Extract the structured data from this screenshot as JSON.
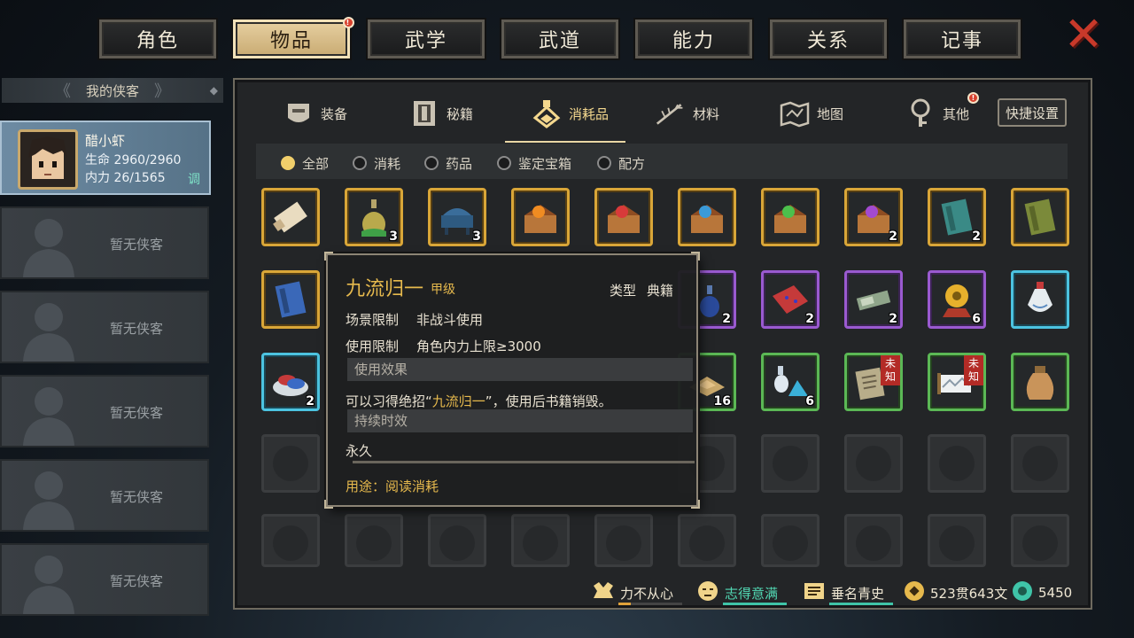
{
  "top_tabs": [
    {
      "label": "角色",
      "active": false
    },
    {
      "label": "物品",
      "active": true,
      "badge": "!"
    },
    {
      "label": "武学",
      "active": false
    },
    {
      "label": "武道",
      "active": false
    },
    {
      "label": "能力",
      "active": false
    },
    {
      "label": "关系",
      "active": false
    },
    {
      "label": "记事",
      "active": false
    }
  ],
  "close_glyph": "✕",
  "sidebar": {
    "title": "我的侠客",
    "hero": {
      "name": "醋小虾",
      "hp_label": "生命 2960/2960",
      "mp_label": "内力 26/1565",
      "adjust_label": "调"
    },
    "empty_slots": [
      "暂无侠客",
      "暂无侠客",
      "暂无侠客",
      "暂无侠客",
      "暂无侠客"
    ]
  },
  "categories": [
    {
      "label": "装备",
      "icon": "armor-icon"
    },
    {
      "label": "秘籍",
      "icon": "book-icon"
    },
    {
      "label": "消耗品",
      "icon": "potion-icon",
      "active": true
    },
    {
      "label": "材料",
      "icon": "herb-icon"
    },
    {
      "label": "地图",
      "icon": "map-icon"
    },
    {
      "label": "其他",
      "icon": "key-icon",
      "badge": "!"
    }
  ],
  "quick_settings_label": "快捷设置",
  "filters": [
    {
      "label": "全部",
      "selected": true
    },
    {
      "label": "消耗",
      "selected": false
    },
    {
      "label": "药品",
      "selected": false
    },
    {
      "label": "鉴定宝箱",
      "selected": false
    },
    {
      "label": "配方",
      "selected": false
    }
  ],
  "items_row1": [
    {
      "icon": "scroll-icon",
      "rarity": "gold",
      "count": ""
    },
    {
      "icon": "gourd-icon",
      "rarity": "gold",
      "count": "3"
    },
    {
      "icon": "incense-burner-icon",
      "rarity": "gold",
      "count": "3"
    },
    {
      "icon": "treasure-chest-orange-icon",
      "rarity": "gold",
      "count": ""
    },
    {
      "icon": "treasure-chest-red-icon",
      "rarity": "gold",
      "count": ""
    },
    {
      "icon": "treasure-chest-blue-icon",
      "rarity": "gold",
      "count": ""
    },
    {
      "icon": "treasure-chest-green-icon",
      "rarity": "gold",
      "count": ""
    },
    {
      "icon": "treasure-chest-purple-icon",
      "rarity": "gold",
      "count": "2"
    },
    {
      "icon": "teal-book-icon",
      "rarity": "gold",
      "count": "2"
    },
    {
      "icon": "olive-book-icon",
      "rarity": "gold",
      "count": ""
    }
  ],
  "items_row2_visible": [
    {
      "icon": "blue-book-icon",
      "rarity": "gold",
      "count": ""
    },
    {
      "icon": "blue-vial-icon",
      "rarity": "purple",
      "count": "2"
    },
    {
      "icon": "red-cloth-icon",
      "rarity": "purple",
      "count": "2"
    },
    {
      "icon": "silver-bundle-icon",
      "rarity": "purple",
      "count": "2"
    },
    {
      "icon": "golden-orb-icon",
      "rarity": "purple",
      "count": "6"
    },
    {
      "icon": "white-vase-icon",
      "rarity": "cyan",
      "count": ""
    }
  ],
  "items_row3_visible": [
    {
      "icon": "pill-plate-icon",
      "rarity": "cyan",
      "count": "2"
    },
    {
      "icon": "food-pile-icon",
      "rarity": "green",
      "count": "16"
    },
    {
      "icon": "crystal-flask-icon",
      "rarity": "green",
      "count": "6"
    },
    {
      "icon": "manual-pages-icon",
      "rarity": "green",
      "count": "",
      "tag": "未知"
    },
    {
      "icon": "painting-scroll-icon",
      "rarity": "green",
      "count": "",
      "tag": "未知"
    },
    {
      "icon": "cloth-sack-icon",
      "rarity": "green",
      "count": ""
    }
  ],
  "tooltip": {
    "name": "九流归一",
    "grade": "甲级",
    "type_label": "类型",
    "type_value": "典籍",
    "scene_label": "场景限制",
    "scene_value": "非战斗使用",
    "use_label": "使用限制",
    "use_value": "角色内力上限≥3000",
    "effect_header": "使用效果",
    "effect_prefix": "可以习得绝招“",
    "effect_highlight": "九流归一",
    "effect_suffix": "”，使用后书籍销毁。",
    "duration_header": "持续时效",
    "duration_value": "永久",
    "usage": "用途：阅读消耗"
  },
  "status_bar": [
    {
      "icon": "strength-icon",
      "label": "力不从心",
      "fill": 0.2,
      "color": "#e0a23a",
      "text_color": "#f0e8d4"
    },
    {
      "icon": "mood-face-icon",
      "label": "志得意满",
      "fill": 1.0,
      "color": "#3fc4a8",
      "text_color": "#52d9b4"
    },
    {
      "icon": "reputation-icon",
      "label": "垂名青史",
      "fill": 1.0,
      "color": "#3fc4a8",
      "text_color": "#f0e8d4"
    },
    {
      "icon": "coin-icon",
      "label": "523贯643文"
    },
    {
      "icon": "jade-icon",
      "label": "5450"
    }
  ]
}
